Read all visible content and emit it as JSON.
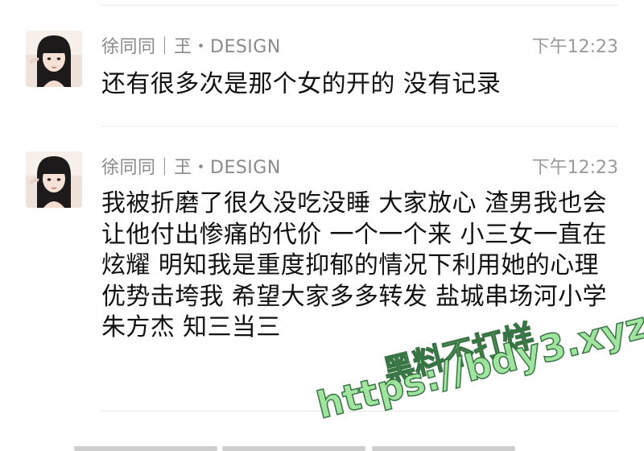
{
  "messages": [
    {
      "sender": "徐同同｜玊・DESIGN",
      "time": "下午12:23",
      "text": "还有很多次是那个女的开的 没有记录"
    },
    {
      "sender": "徐同同｜玊・DESIGN",
      "time": "下午12:23",
      "text": "我被折磨了很久没吃没睡 大家放心 渣男我也会让他付出惨痛的代价 一个一个来 小三女一直在炫耀 明知我是重度抑郁的情况下利用她的心理优势击垮我 希望大家多多转发 盐城串场河小学 朱方杰 知三当三"
    }
  ],
  "watermark": {
    "line1": "黑料不打烊",
    "line2": "https://bdy3.xyz"
  },
  "colors": {
    "sender": "#8a8a8a",
    "time": "#9a9a9a",
    "text": "#111111",
    "divider": "#e8e8e8",
    "watermark_fill": "#9be39b",
    "watermark_stroke": "#2f6e3a"
  },
  "icons": {
    "avatar": "avatar-photo"
  }
}
